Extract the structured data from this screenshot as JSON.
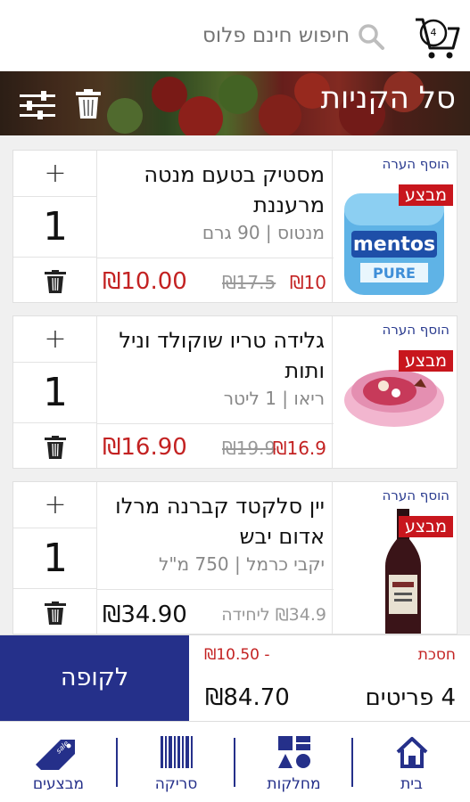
{
  "header": {
    "cart_count": "4",
    "search_placeholder": "חיפוש חינם פלוס"
  },
  "banner": {
    "title": "סל הקניות"
  },
  "products": [
    {
      "name_line1": "מסטיק בטעם מנטה",
      "name_line2": "מרעננת",
      "brand": "מנטוס | 90 גרם",
      "quantity": "1",
      "plus": "+",
      "sale_price": "₪10",
      "original_price": "₪17.5",
      "total": "₪10.00",
      "note_label": "הוסף הערה",
      "badge": "מבצע",
      "image_label": "mentos"
    },
    {
      "name_line1": "גלידה טריו שוקולד וניל",
      "name_line2": "ותות",
      "brand": "ריאו | 1 ליטר",
      "quantity": "1",
      "plus": "+",
      "sale_price": "₪16.9",
      "original_price": "₪19.9",
      "total": "₪16.90",
      "note_label": "הוסף הערה",
      "badge": "מבצע"
    },
    {
      "name_line1": "יין סלקטד קברנה מרלו",
      "name_line2": "אדום יבש",
      "brand": "יקבי כרמל | 750 מ\"ל",
      "quantity": "1",
      "plus": "+",
      "unit_price": "₪34.9 ליחידה",
      "total": "₪34.90",
      "note_label": "הוסף הערה",
      "badge": "מבצע"
    }
  ],
  "checkout": {
    "button_label": "לקופה",
    "savings_label": "חסכת",
    "savings_value": "₪10.50 -",
    "items_count": "4 פריטים",
    "total": "₪84.70"
  },
  "nav": {
    "home": "בית",
    "departments": "מחלקות",
    "scan": "סריקה",
    "deals": "מבצעים",
    "deals_tag": "sale"
  },
  "colors": {
    "brand_blue": "#25308a",
    "sale_red": "#c8161d",
    "price_red": "#c32222"
  }
}
